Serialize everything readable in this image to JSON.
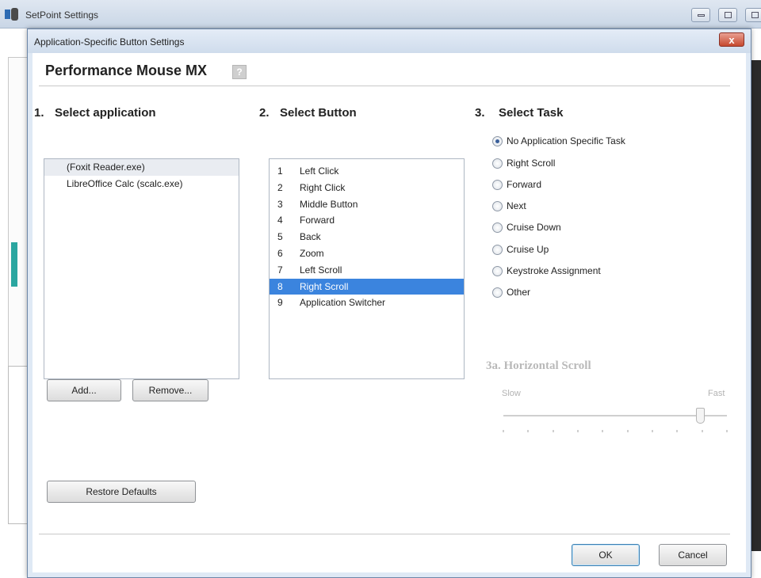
{
  "outer_window": {
    "title": "SetPoint Settings",
    "app_icon": "setpoint-logo-icon",
    "controls": [
      "minimize-icon",
      "maximize-icon",
      "close-icon"
    ]
  },
  "dialog": {
    "title": "Application-Specific Button Settings",
    "close_glyph": "x",
    "device_name": "Performance Mouse MX",
    "help_glyph": "?"
  },
  "select_application": {
    "number": "1.",
    "heading": "Select application",
    "items": [
      {
        "label": "(Foxit Reader.exe)",
        "selected": true
      },
      {
        "label": "LibreOffice Calc (scalc.exe)",
        "selected": false
      }
    ],
    "add_label": "Add...",
    "remove_label": "Remove..."
  },
  "select_button": {
    "number": "2.",
    "heading": "Select Button",
    "items": [
      {
        "num": "1",
        "label": "Left Click"
      },
      {
        "num": "2",
        "label": "Right Click"
      },
      {
        "num": "3",
        "label": "Middle Button"
      },
      {
        "num": "4",
        "label": "Forward"
      },
      {
        "num": "5",
        "label": "Back"
      },
      {
        "num": "6",
        "label": "Zoom"
      },
      {
        "num": "7",
        "label": "Left Scroll"
      },
      {
        "num": "8",
        "label": "Right Scroll"
      },
      {
        "num": "9",
        "label": "Application Switcher"
      }
    ],
    "selected_index": 7
  },
  "select_task": {
    "number": "3.",
    "heading": "Select Task",
    "options": [
      {
        "label": "No Application Specific Task",
        "checked": true
      },
      {
        "label": "Right Scroll",
        "checked": false
      },
      {
        "label": "Forward",
        "checked": false
      },
      {
        "label": "Next",
        "checked": false
      },
      {
        "label": "Cruise Down",
        "checked": false
      },
      {
        "label": "Cruise Up",
        "checked": false
      },
      {
        "label": "Keystroke Assignment",
        "checked": false
      },
      {
        "label": "Other",
        "checked": false
      }
    ]
  },
  "horizontal_scroll": {
    "heading": "3a. Horizontal Scroll",
    "slow_label": "Slow",
    "fast_label": "Fast",
    "speed_fraction": 0.88,
    "tick_count": 10
  },
  "footer": {
    "restore_defaults_label": "Restore Defaults",
    "ok_label": "OK",
    "cancel_label": "Cancel"
  },
  "colors": {
    "selection_blue": "#3b84de",
    "accent_teal": "#2aa6a0",
    "close_red": "#c6492f"
  }
}
